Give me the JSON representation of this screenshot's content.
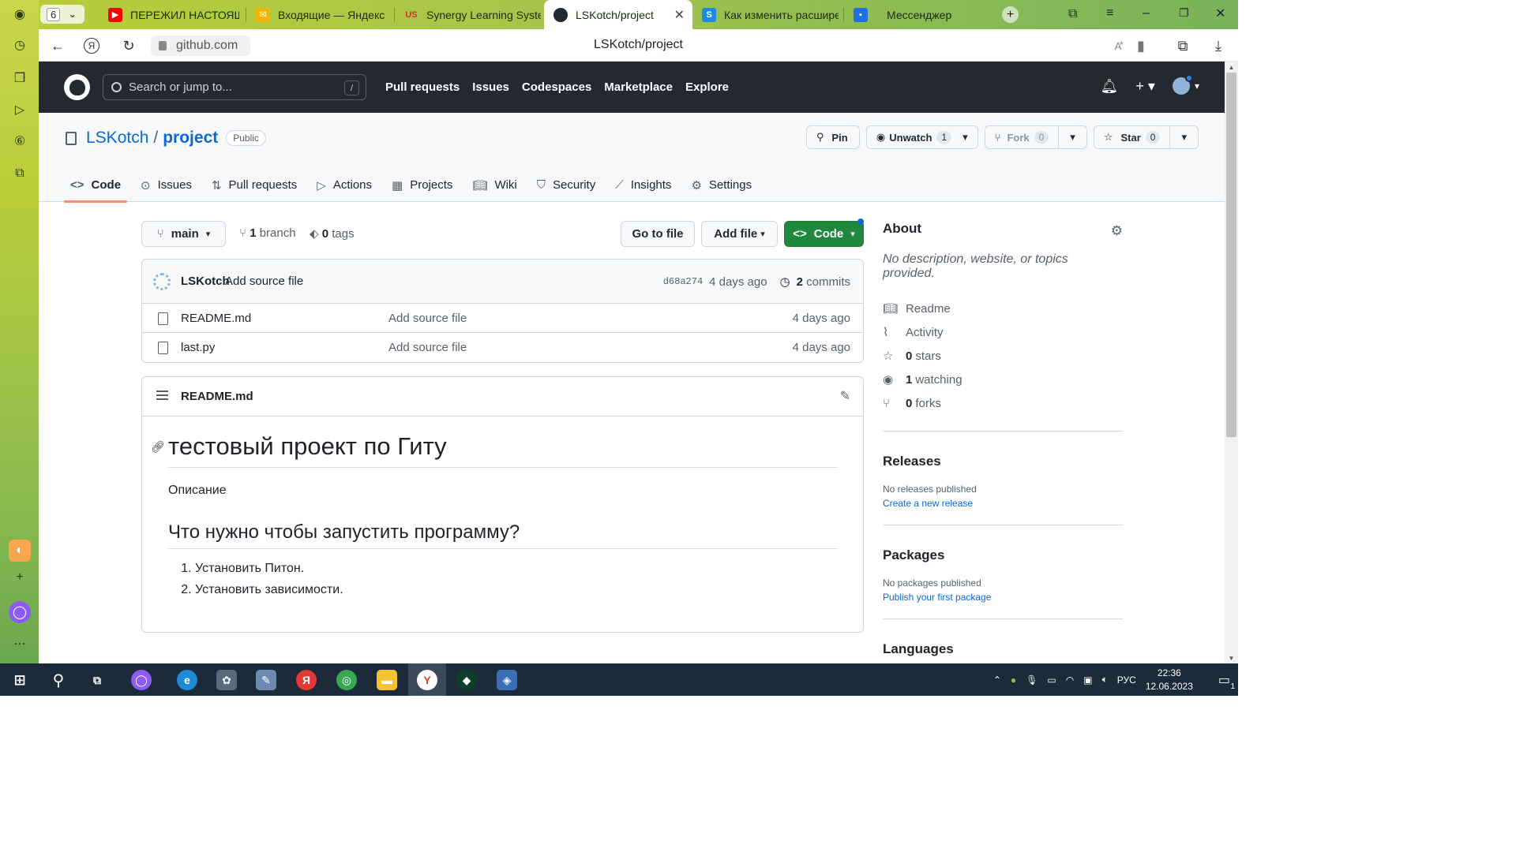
{
  "browser": {
    "tab_counter": "6",
    "tabs": [
      {
        "title": "ПЕРЕЖИЛ НАСТОЯЩЕЕ",
        "icon": "youtube-icon",
        "color": "#ff0000"
      },
      {
        "title": "Входящие — Яндекс По",
        "icon": "mail-icon",
        "color": "#f4b400"
      },
      {
        "title": "Synergy Learning Syster",
        "icon": "synergy-icon",
        "color": "#d32f2f"
      },
      {
        "title": "LSKotch/project",
        "icon": "github-icon",
        "color": "#24292f"
      },
      {
        "title": "Как изменить расшире",
        "icon": "skysmart-icon",
        "color": "#1e88e5"
      },
      {
        "title": "Мессенджер",
        "icon": "messenger-icon",
        "color": "#1e6fe0"
      }
    ],
    "url_domain": "github.com",
    "page_title": "LSKotch/project"
  },
  "github": {
    "search_placeholder": "Search or jump to...",
    "search_shortcut": "/",
    "nav": [
      "Pull requests",
      "Issues",
      "Codespaces",
      "Marketplace",
      "Explore"
    ]
  },
  "repo": {
    "owner": "LSKotch",
    "name": "project",
    "visibility": "Public",
    "pin_label": "Pin",
    "unwatch_label": "Unwatch",
    "unwatch_count": "1",
    "fork_label": "Fork",
    "fork_count": "0",
    "star_label": "Star",
    "star_count": "0",
    "tabs": [
      "Code",
      "Issues",
      "Pull requests",
      "Actions",
      "Projects",
      "Wiki",
      "Security",
      "Insights",
      "Settings"
    ]
  },
  "code": {
    "branch": "main",
    "branch_count": "1",
    "branch_word": "branch",
    "tag_count": "0",
    "tag_word": "tags",
    "go_to_file": "Go to file",
    "add_file": "Add file",
    "code_button": "Code",
    "latest_commit": {
      "author": "LSKotch",
      "message": "Add source file",
      "sha": "d68a274",
      "age": "4 days ago",
      "commit_count": "2",
      "commit_word": "commits"
    },
    "files": [
      {
        "name": "README.md",
        "commit": "Add source file",
        "age": "4 days ago"
      },
      {
        "name": "last.py",
        "commit": "Add source file",
        "age": "4 days ago"
      }
    ]
  },
  "readme": {
    "filename": "README.md",
    "h1": "тестовый проект по Гиту",
    "paragraph": "Описание",
    "h2": "Что нужно чтобы запустить программу?",
    "steps": [
      "Установить Питон.",
      "Установить зависимости."
    ]
  },
  "about": {
    "heading": "About",
    "description": "No description, website, or topics provided.",
    "readme": "Readme",
    "activity": "Activity",
    "stars_count": "0",
    "stars_word": "stars",
    "watching_count": "1",
    "watching_word": "watching",
    "forks_count": "0",
    "forks_word": "forks",
    "releases_heading": "Releases",
    "releases_text": "No releases published",
    "releases_link": "Create a new release",
    "packages_heading": "Packages",
    "packages_text": "No packages published",
    "packages_link": "Publish your first package",
    "languages_heading": "Languages"
  },
  "taskbar": {
    "language": "РУС",
    "time": "22:36",
    "date": "12.06.2023",
    "notifications": "1"
  }
}
